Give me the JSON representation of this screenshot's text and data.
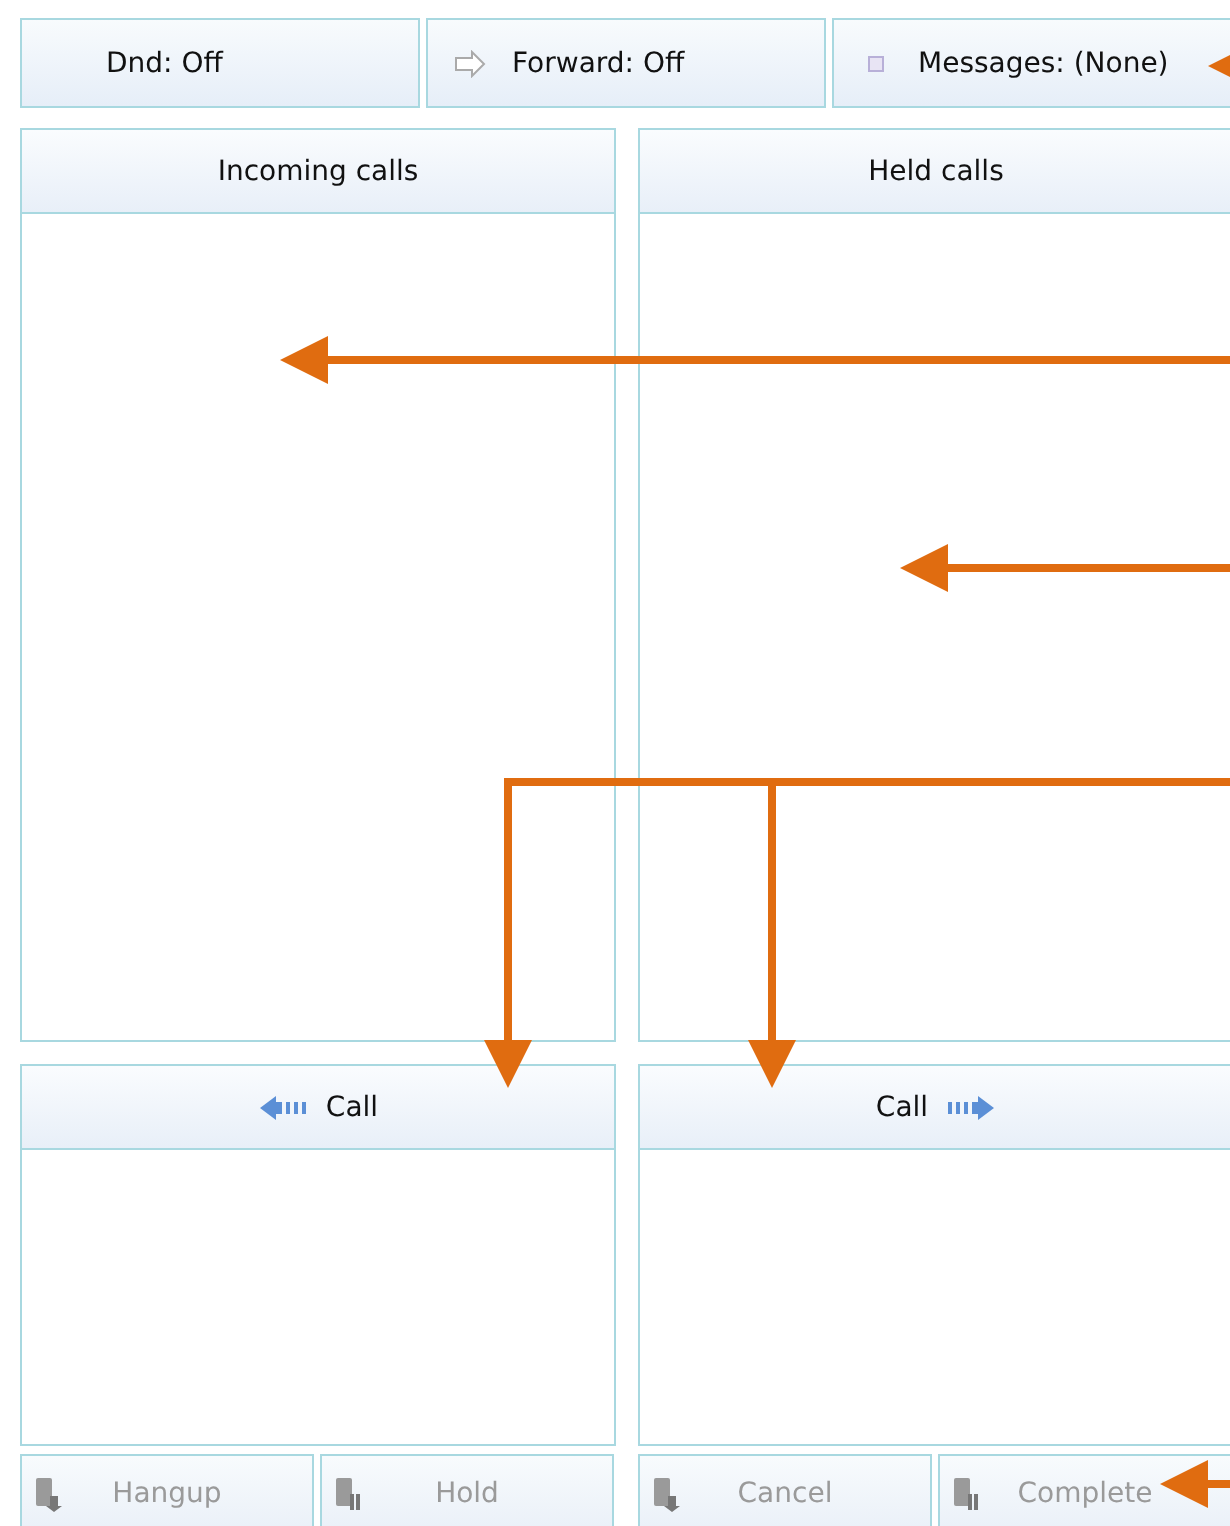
{
  "toolbar": [
    {
      "label": "Dnd: Off",
      "kind": "dnd"
    },
    {
      "label": "Forward: Off",
      "kind": "forward"
    },
    {
      "label": "Messages: (None)",
      "kind": "messages"
    }
  ],
  "panels": [
    {
      "title": "Incoming calls"
    },
    {
      "title": "Held calls"
    }
  ],
  "call_panels": [
    {
      "label": "Call",
      "kind": "back"
    },
    {
      "label": "Call",
      "kind": "forward"
    }
  ],
  "action_buttons": [
    {
      "label": "Hangup",
      "kind": "hangup",
      "disabled": true
    },
    {
      "label": "Hold",
      "kind": "hold",
      "disabled": true
    },
    {
      "label": "Cancel",
      "kind": "hangup",
      "disabled": true
    },
    {
      "label": "Complete",
      "kind": "hold",
      "disabled": true
    }
  ]
}
